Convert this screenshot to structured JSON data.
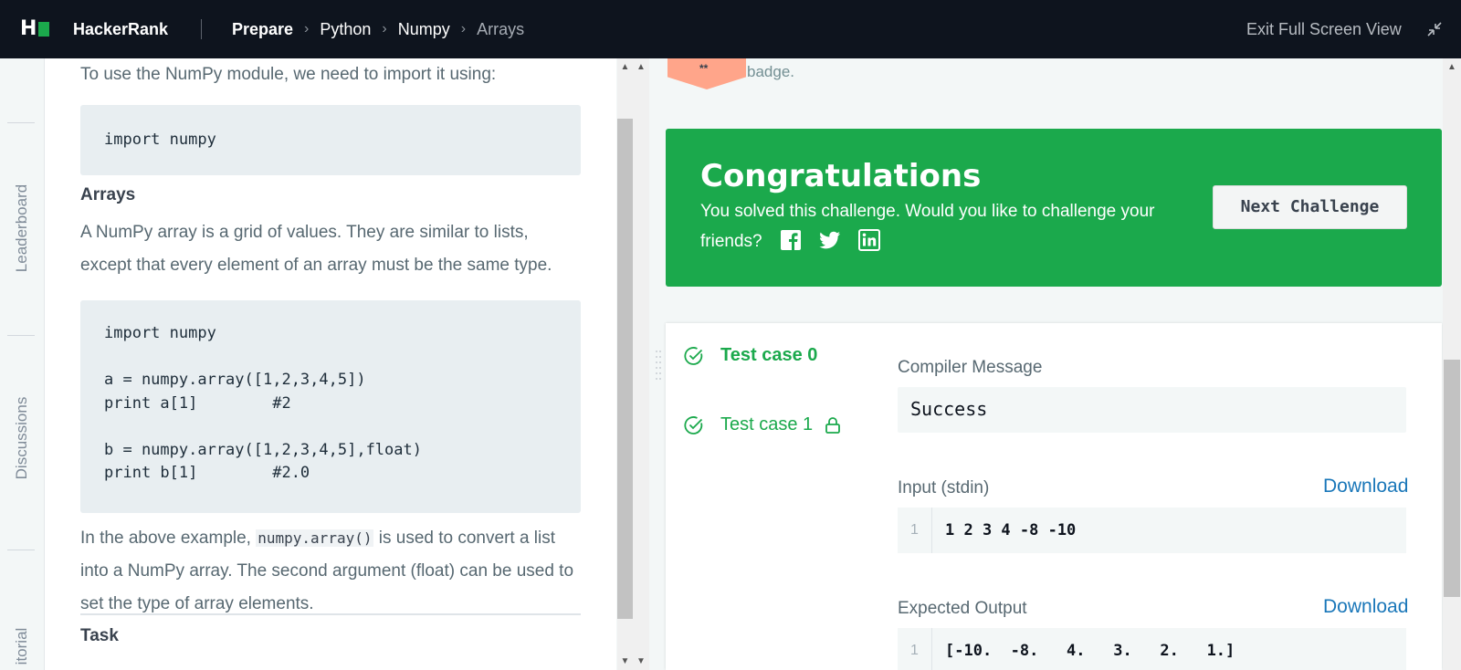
{
  "header": {
    "brand": "HackerRank",
    "breadcrumbs": [
      "Prepare",
      "Python",
      "Numpy",
      "Arrays"
    ],
    "exit_label": "Exit Full Screen View"
  },
  "leftnav": {
    "items": [
      "Leaderboard",
      "Discussions",
      "itorial"
    ]
  },
  "problem": {
    "intro": "To use the NumPy module, we need to import it using:",
    "code1": "import numpy",
    "arrays_heading": "Arrays",
    "arrays_text": "A NumPy array is a grid of values. They are similar to lists, except that every element of an array must be the same type.",
    "code2": "import numpy\n\na = numpy.array([1,2,3,4,5])\nprint a[1]        #2\n\nb = numpy.array([1,2,3,4,5],float)\nprint b[1]        #2.0",
    "example_pre": "In the above example,",
    "example_code": "numpy.array()",
    "example_post": "is used to convert a list into a NumPy array. The second argument (float) can be used to set the type of array elements.",
    "task_heading": "Task"
  },
  "badge": {
    "stars": "**",
    "text": "badge."
  },
  "congrats": {
    "title": "Congratulations",
    "message": "You solved this challenge. Would you like to challenge your friends?",
    "next_label": "Next Challenge",
    "share_icons": [
      "facebook-icon",
      "twitter-icon",
      "linkedin-icon"
    ],
    "bg_color": "#1ba94c"
  },
  "tests": {
    "cases": [
      {
        "label": "Test case 0",
        "status": "passed",
        "active": true
      },
      {
        "label": "Test case 1",
        "status": "passed",
        "locked": true
      }
    ],
    "compiler_label": "Compiler Message",
    "compiler_value": "Success",
    "input_label": "Input (stdin)",
    "download_label": "Download",
    "input_line_no": "1",
    "input_value": "1 2 3 4 -8 -10",
    "expected_label": "Expected Output",
    "expected_line_no": "1",
    "expected_value": "[-10.  -8.   4.   3.   2.   1.]"
  }
}
